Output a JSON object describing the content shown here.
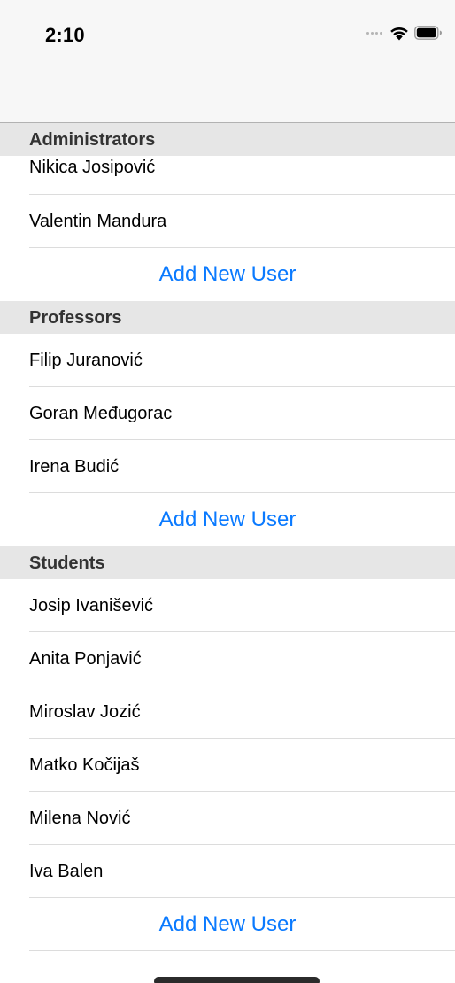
{
  "status_bar": {
    "time": "2:10"
  },
  "sections": [
    {
      "title": "Administrators",
      "users": [
        "Nikica Josipović",
        "Valentin Mandura"
      ],
      "add_label": "Add New User"
    },
    {
      "title": "Professors",
      "users": [
        "Filip Juranović",
        "Goran Međugorac",
        "Irena Budić"
      ],
      "add_label": "Add New User"
    },
    {
      "title": "Students",
      "users": [
        "Josip Ivanišević",
        "Anita Ponjavić",
        "Miroslav Jozić",
        "Matko Kočijaš",
        "Milena Nović",
        "Iva Balen"
      ],
      "add_label": "Add New User"
    }
  ],
  "colors": {
    "accent": "#0a7aff",
    "section_header_bg": "#e6e6e6",
    "bar_bg": "#f7f7f7"
  }
}
